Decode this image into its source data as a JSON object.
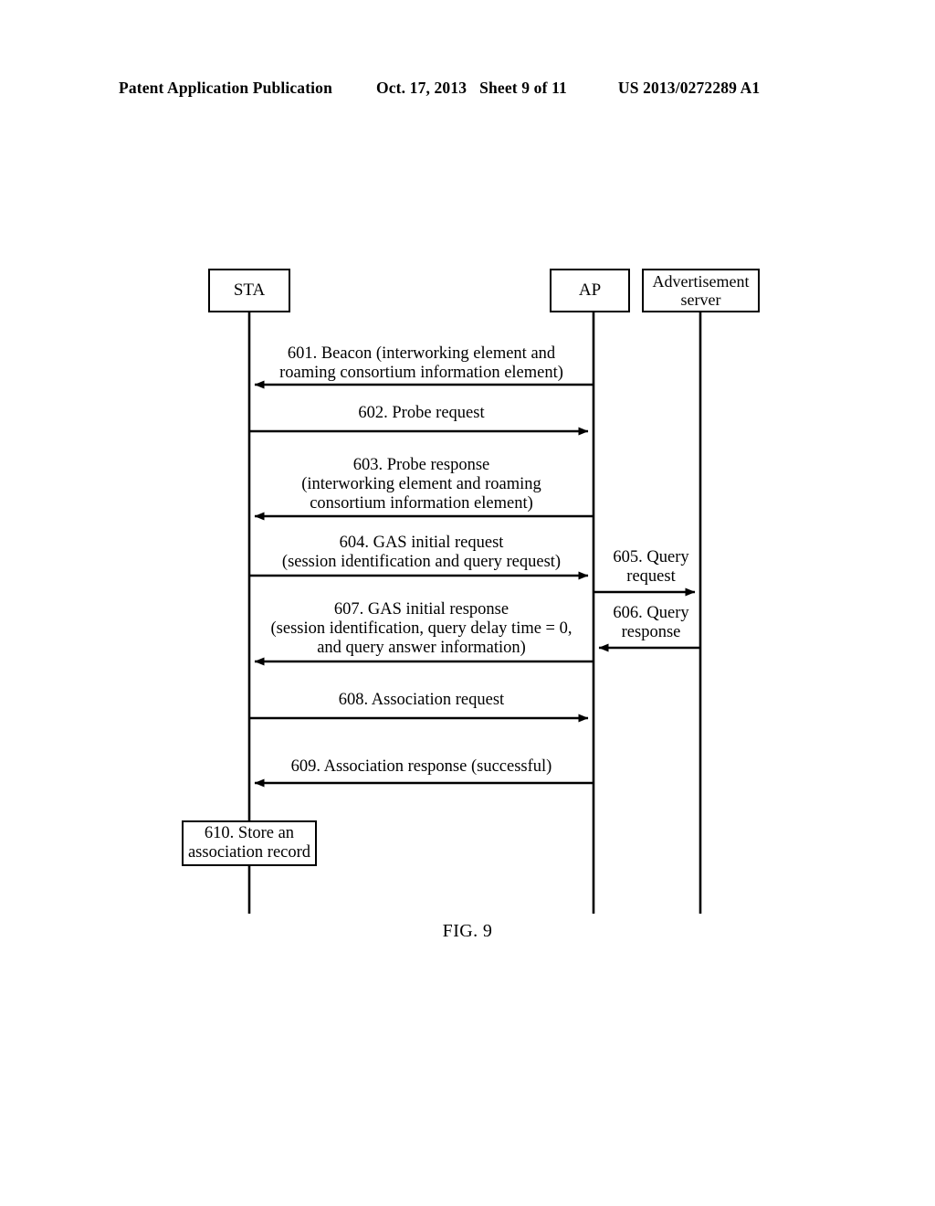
{
  "header": {
    "title": "Patent Application Publication",
    "date": "Oct. 17, 2013",
    "sheet": "Sheet 9 of 11",
    "publication_number": "US 2013/0272289 A1"
  },
  "figure": {
    "caption": "FIG. 9",
    "actors": [
      {
        "id": "sta",
        "label": "STA"
      },
      {
        "id": "ap",
        "label": "AP"
      },
      {
        "id": "ad_server",
        "label": "Advertisement\nserver"
      }
    ],
    "messages": [
      {
        "id": "m601",
        "number": "601",
        "label": "601. Beacon (interworking element and\nroaming consortium information element)",
        "from": "ap",
        "to": "sta",
        "direction": "left"
      },
      {
        "id": "m602",
        "number": "602",
        "label": "602. Probe request",
        "from": "sta",
        "to": "ap",
        "direction": "right"
      },
      {
        "id": "m603",
        "number": "603",
        "label": "603. Probe response\n(interworking element and roaming\nconsortium information element)",
        "from": "ap",
        "to": "sta",
        "direction": "left"
      },
      {
        "id": "m604",
        "number": "604",
        "label": "604. GAS initial request\n(session identification and query request)",
        "from": "sta",
        "to": "ap",
        "direction": "right"
      },
      {
        "id": "m605",
        "number": "605",
        "label": "605. Query\nrequest",
        "from": "ap",
        "to": "ad_server",
        "direction": "right"
      },
      {
        "id": "m606",
        "number": "606",
        "label": "606. Query\nresponse",
        "from": "ad_server",
        "to": "ap",
        "direction": "left"
      },
      {
        "id": "m607",
        "number": "607",
        "label": "607. GAS initial response\n(session identification, query delay time = 0,\nand query answer information)",
        "from": "ap",
        "to": "sta",
        "direction": "left"
      },
      {
        "id": "m608",
        "number": "608",
        "label": "608. Association request",
        "from": "sta",
        "to": "ap",
        "direction": "right"
      },
      {
        "id": "m609",
        "number": "609",
        "label": "609. Association response (successful)",
        "from": "ap",
        "to": "sta",
        "direction": "left"
      }
    ],
    "notes": [
      {
        "id": "n610",
        "number": "610",
        "label": "610. Store an\nassociation record",
        "on": "sta"
      }
    ]
  }
}
